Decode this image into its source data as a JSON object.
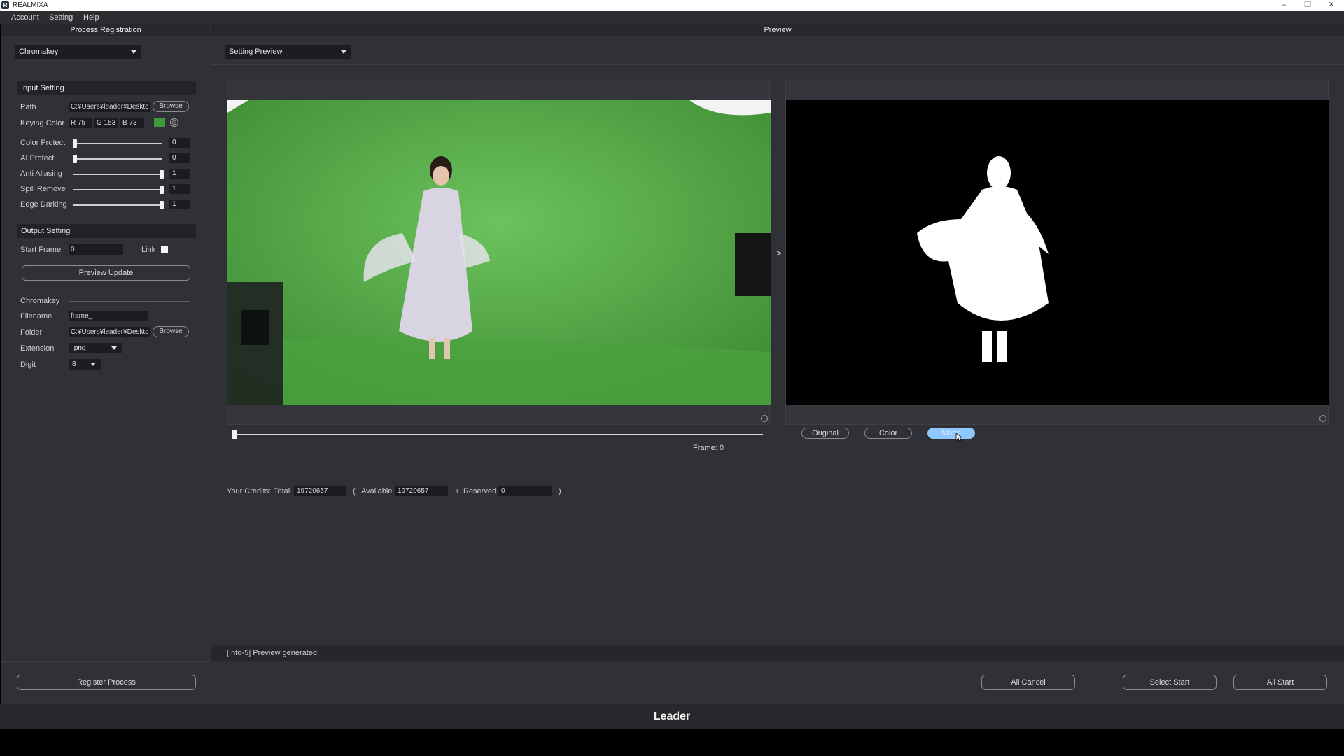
{
  "window": {
    "title": "REALMIXA",
    "minimize": "–",
    "restore": "❐",
    "close": "✕"
  },
  "menu": [
    "Account",
    "Setting",
    "Help"
  ],
  "left": {
    "header": "Process Registration",
    "process_select": "Chromakey",
    "input_section": "Input Setting",
    "path_label": "Path",
    "path_value": "C:¥Users¥leader¥Desktc",
    "browse": "Browse",
    "keying_label": "Keying Color",
    "keying_r": "R 75",
    "keying_g": "G 153",
    "keying_b": "B 73",
    "keying_swatch": "#3f9a3c",
    "sliders": [
      {
        "label": "Color Protect",
        "value": "0",
        "level": 0
      },
      {
        "label": "AI Protect",
        "value": "0",
        "level": 0
      },
      {
        "label": "Anti Aliasing",
        "value": "1",
        "level": 1
      },
      {
        "label": "Spill Remove",
        "value": "1",
        "level": 1
      },
      {
        "label": "Edge Darking",
        "value": "1",
        "level": 1
      }
    ],
    "output_section": "Output Setting",
    "start_frame_label": "Start Frame",
    "start_frame_value": "0",
    "link_label": "Link",
    "preview_update": "Preview Update",
    "chromakey_label": "Chromakey",
    "filename_label": "Filename",
    "filename_value": "frame_",
    "folder_label": "Folder",
    "folder_value": "C:¥Users¥leader¥Desktc",
    "extension_label": "Extension",
    "extension_value": ".png",
    "digit_label": "Digit",
    "digit_value": "8",
    "register": "Register Process"
  },
  "main": {
    "header": "Preview",
    "preview_select": "Setting Preview",
    "arrow": ">",
    "frame_label": "Frame:",
    "frame_value": "0",
    "modes": [
      "Original",
      "Color",
      "Matte"
    ],
    "credits_label": "Your Credits:",
    "total_label": "Total",
    "total_value": "19720657",
    "open_paren": "(",
    "available_label": "Available",
    "available_value": "19720657",
    "plus": "+",
    "reserved_label": "Reserved",
    "reserved_value": "0",
    "close_paren": ")",
    "status": "[Info-5] Preview generated.",
    "all_cancel": "All Cancel",
    "select_start": "Select Start",
    "all_start": "All Start"
  },
  "footer": "Leader"
}
